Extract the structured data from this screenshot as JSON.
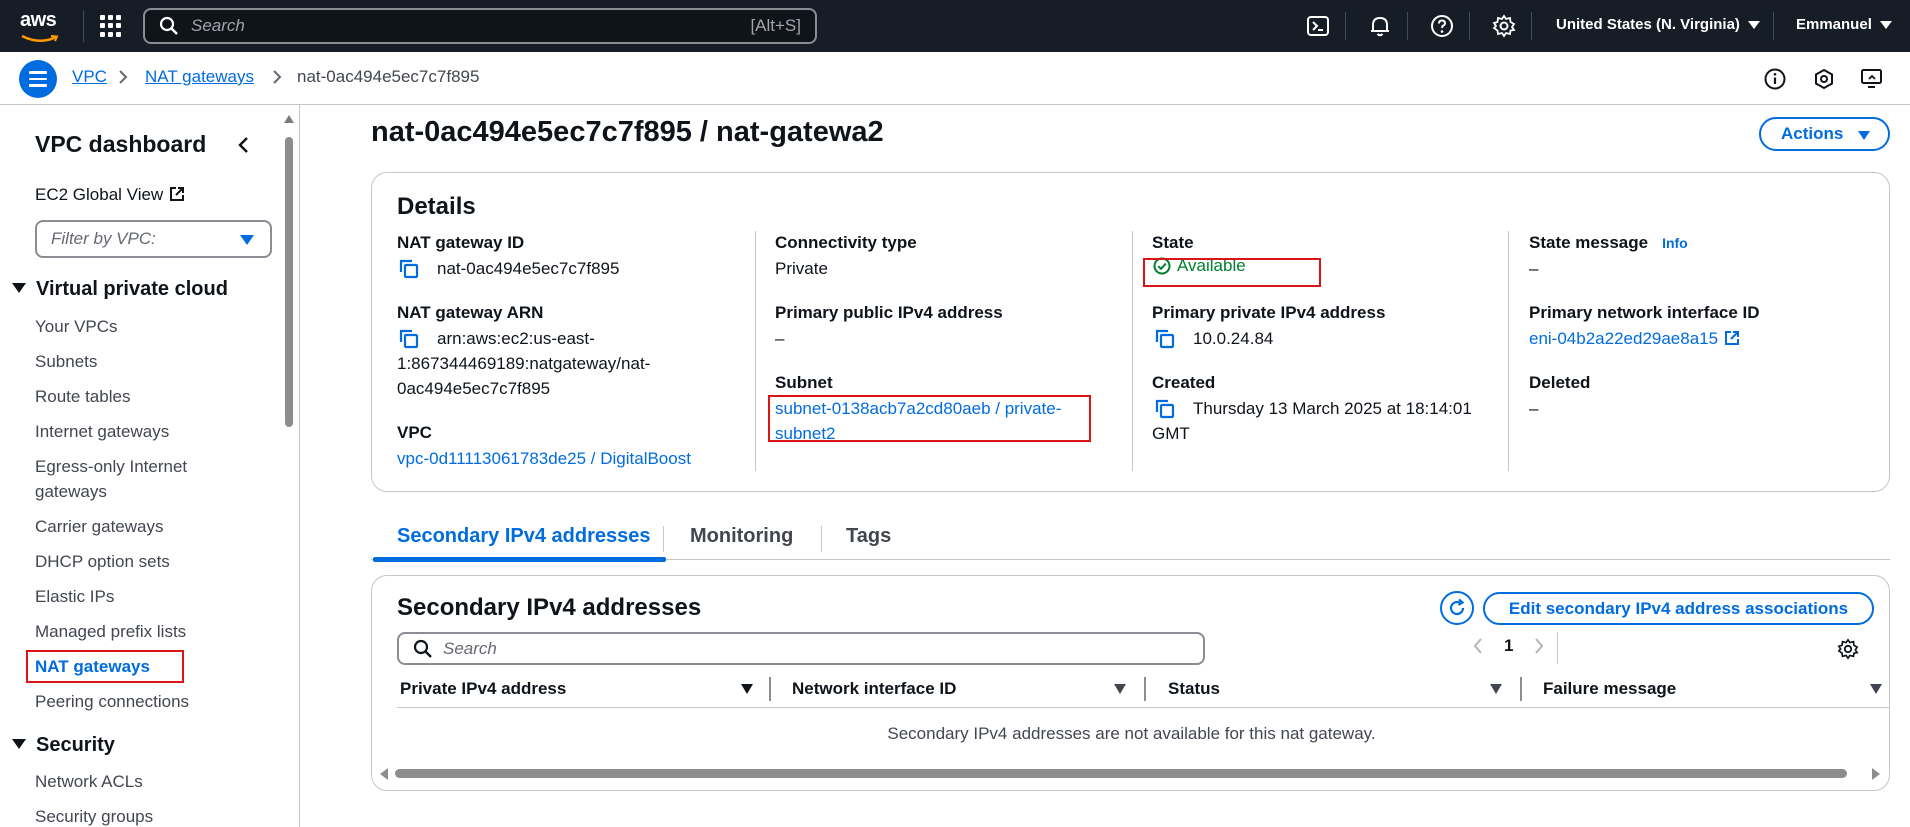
{
  "topnav": {
    "logo": "aws",
    "search_placeholder": "Search",
    "search_shortcut": "[Alt+S]",
    "region": "United States (N. Virginia)",
    "user": "Emmanuel",
    "icons": [
      "cloudshell-icon",
      "bell-icon",
      "help-icon",
      "settings-icon"
    ]
  },
  "breadcrumb": {
    "items": [
      "VPC",
      "NAT gateways"
    ],
    "current": "nat-0ac494e5ec7c7f895"
  },
  "sidebar": {
    "title": "VPC dashboard",
    "ec2_link": "EC2 Global View",
    "filter_placeholder": "Filter by VPC:",
    "section_vpc": "Virtual private cloud",
    "items": [
      "Your VPCs",
      "Subnets",
      "Route tables",
      "Internet gateways",
      "Egress-only Internet gateways",
      "Carrier gateways",
      "DHCP option sets",
      "Elastic IPs",
      "Managed prefix lists",
      "NAT gateways",
      "Peering connections"
    ],
    "section_security": "Security",
    "security_items": [
      "Network ACLs",
      "Security groups"
    ]
  },
  "page": {
    "title": "nat-0ac494e5ec7c7f895 / nat-gatewa2",
    "actions_label": "Actions"
  },
  "details": {
    "title": "Details",
    "nat_id_label": "NAT gateway ID",
    "nat_id": "nat-0ac494e5ec7c7f895",
    "arn_label": "NAT gateway ARN",
    "arn_line1": "arn:aws:ec2:us-east-",
    "arn_line2": "1:867344469189:natgateway/nat-",
    "arn_line3": "0ac494e5ec7c7f895",
    "vpc_label": "VPC",
    "vpc": "vpc-0d11113061783de25 / DigitalBoost",
    "conn_label": "Connectivity type",
    "conn": "Private",
    "pub_ip_label": "Primary public IPv4 address",
    "pub_ip": "–",
    "subnet_label": "Subnet",
    "subnet_line1": "subnet-0138acb7a2cd80aeb / private-",
    "subnet_line2": "subnet2",
    "state_label": "State",
    "state": "Available",
    "priv_ip_label": "Primary private IPv4 address",
    "priv_ip": "10.0.24.84",
    "created_label": "Created",
    "created_line1": "Thursday 13 March 2025 at 18:14:01",
    "created_line2": "GMT",
    "state_msg_label": "State message",
    "info": "Info",
    "state_msg": "–",
    "eni_label": "Primary network interface ID",
    "eni": "eni-04b2a22ed29ae8a15",
    "deleted_label": "Deleted",
    "deleted": "–"
  },
  "tabs": [
    "Secondary IPv4 addresses",
    "Monitoring",
    "Tags"
  ],
  "secondary": {
    "title": "Secondary IPv4 addresses",
    "edit_label": "Edit secondary IPv4 address associations",
    "search_placeholder": "Search",
    "page": "1",
    "columns": [
      "Private IPv4 address",
      "Network interface ID",
      "Status",
      "Failure message"
    ],
    "empty": "Secondary IPv4 addresses are not available for this nat gateway."
  },
  "colors": {
    "accent": "#006ce0",
    "nav_bg": "#161d26",
    "success": "#00802f",
    "highlight": "#d91515"
  }
}
